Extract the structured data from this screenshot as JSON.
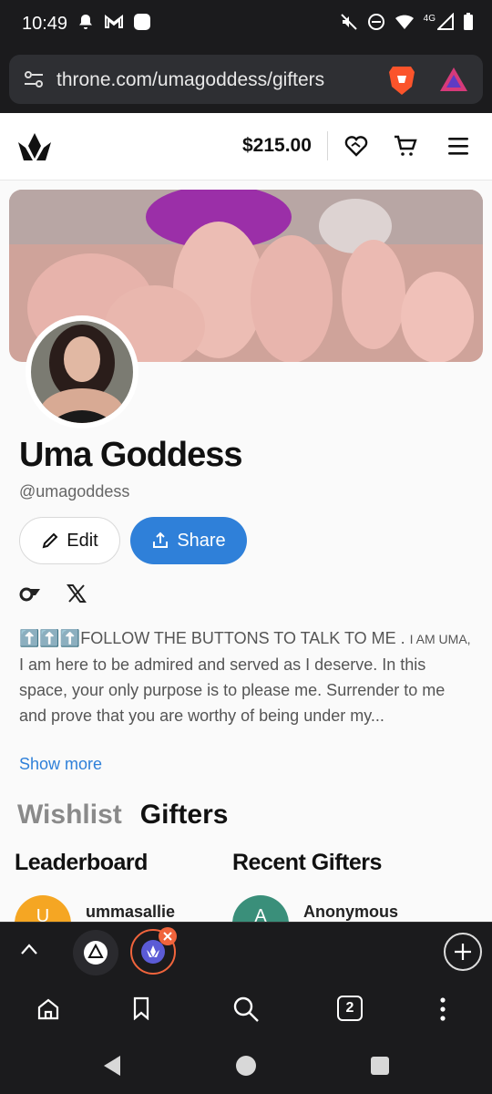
{
  "status_bar": {
    "time": "10:49",
    "network": "4G"
  },
  "browser": {
    "url": "throne.com/umagoddess/gifters",
    "tab_count": "2"
  },
  "site": {
    "balance": "$215.00"
  },
  "profile": {
    "name": "Uma Goddess",
    "handle": "@umagoddess",
    "edit_label": "Edit",
    "share_label": "Share",
    "bio_prefix": "⬆️⬆️⬆️FOLLOW THE BUTTONS TO TALK TO ME . ",
    "bio_smallcaps": "I AM UMA,",
    "bio_body": "I am here to be admired and served as I deserve. In this space, your only purpose is to please me. Surrender to me and prove that you are worthy of being under my...",
    "show_more": "Show more"
  },
  "tabs": {
    "wishlist": "Wishlist",
    "gifters": "Gifters"
  },
  "leaderboard": {
    "title": "Leaderboard",
    "entries": [
      {
        "initial": "U",
        "name": "ummasallie"
      }
    ]
  },
  "recent_gifters": {
    "title": "Recent Gifters",
    "entries": [
      {
        "initial": "A",
        "name": "Anonymous"
      }
    ]
  },
  "colors": {
    "accent": "#2f80d9",
    "leaderboard_avatar": "#f5a623",
    "recent_avatar": "#3a8f7a",
    "tab_close": "#f0643c"
  },
  "icons": [
    "wifi-icon",
    "signal-icon",
    "battery-icon",
    "brave-lion-icon",
    "throne-logo-icon",
    "heart-handshake-icon",
    "cart-icon",
    "menu-icon",
    "onlyfans-icon",
    "x-icon",
    "home-icon",
    "bookmark-icon",
    "search-icon",
    "more-icon"
  ]
}
